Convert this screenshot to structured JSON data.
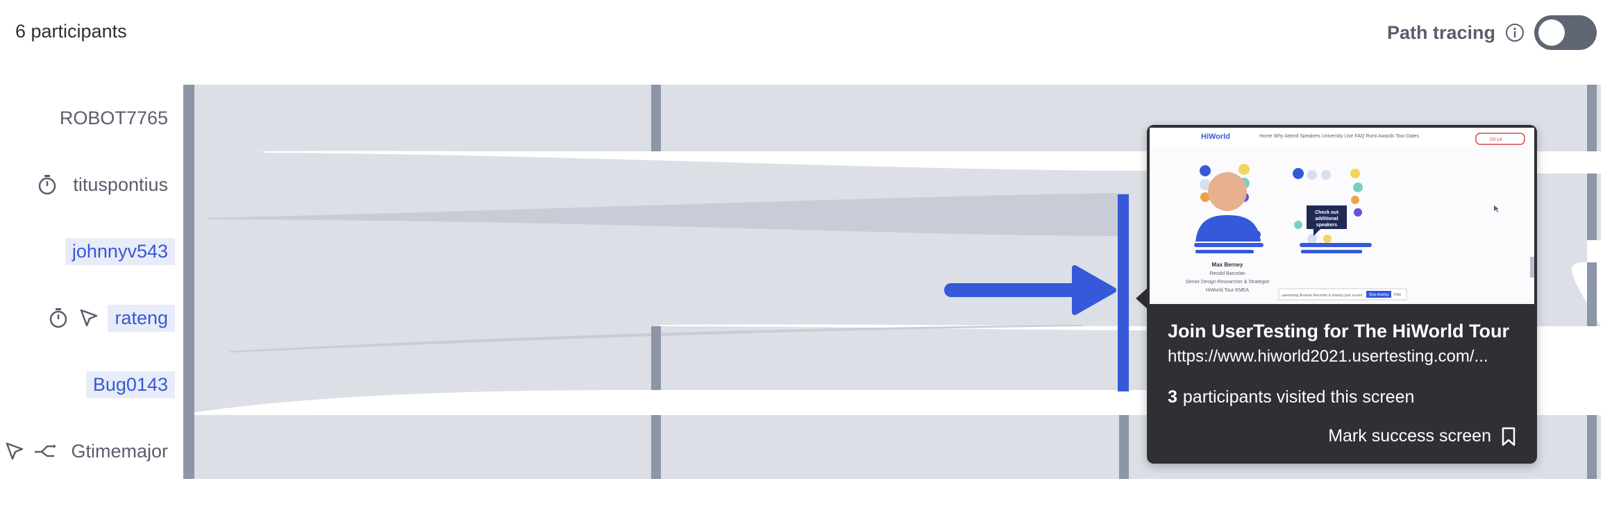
{
  "header": {
    "participant_count": "6 participants",
    "path_tracing_label": "Path tracing",
    "path_tracing_enabled": false
  },
  "participants": [
    {
      "name": "ROBOT7765",
      "icons": [],
      "highlighted": false
    },
    {
      "name": "tituspontius",
      "icons": [
        "stopwatch-icon"
      ],
      "highlighted": false
    },
    {
      "name": "johnnyv543",
      "icons": [],
      "highlighted": true
    },
    {
      "name": "rateng",
      "icons": [
        "stopwatch-icon",
        "cursor-click-icon"
      ],
      "highlighted": true
    },
    {
      "name": "Bug0143",
      "icons": [],
      "highlighted": true
    },
    {
      "name": "Gtimemajor",
      "icons": [
        "cursor-click-icon",
        "branch-icon"
      ],
      "highlighted": false
    }
  ],
  "tooltip": {
    "title": "Join UserTesting for The HiWorld Tour",
    "url": "https://www.hiworld2021.usertesting.com/...",
    "visit_count": "3",
    "visit_text": "participants visited this screen",
    "mark_label": "Mark success screen",
    "screenshot": {
      "logo": "HiWorld",
      "nav": [
        "Home",
        "Why Attend",
        "Speakers",
        "University Live",
        "FAQ",
        "Rumi Awards",
        "Tour Dates"
      ],
      "bubble_text": "Check out additional speakers",
      "speaker_name": "Max Berney",
      "speaker_company": "Recald Barcelan",
      "speaker_role": "Senior Design Researcher & Strategist",
      "speaker_event": "HiWorld Tour EMEA",
      "recorder_text": "usertesting Browser Recorder is sharing your screen",
      "stop_label": "Stop sharing",
      "hide_label": "Hide",
      "timer": "03:14"
    }
  },
  "colors": {
    "flow": "#dcdfe6",
    "column": "#8d96a7",
    "accent": "#3559d8",
    "tooltip_bg": "#2f3034"
  }
}
